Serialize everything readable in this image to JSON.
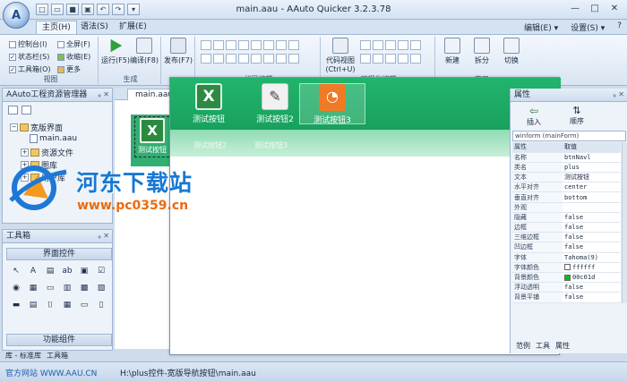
{
  "window": {
    "title": "main.aau - AAuto Quicker 3.2.3.78",
    "min": "—",
    "max": "□",
    "close": "✕"
  },
  "app_orb": "A",
  "ribbon": {
    "tabs": [
      "主页(H)",
      "语法(S)",
      "扩展(E)"
    ],
    "right_menu": [
      "编辑(E) ▾",
      "设置(S) ▾",
      "?"
    ],
    "view_group": {
      "label": "视图",
      "checks": [
        {
          "label": "控制台(I)",
          "checked": false
        },
        {
          "label": "状态栏(S)",
          "checked": true
        },
        {
          "label": "工具箱(O)",
          "checked": true
        },
        {
          "label": "全屏(F)",
          "checked": false
        },
        {
          "label": "收缩(E)",
          "checked": false
        },
        {
          "label": "更多",
          "checked": false
        }
      ]
    },
    "build_group": {
      "label": "生成",
      "buttons": [
        "运行(F5)",
        "编译(F8)"
      ]
    },
    "publish_button": "发布(F7)",
    "code_group_label": "代码编辑",
    "visual_group_label": "可视化编辑",
    "code_view_button": [
      "代码视图",
      "(Ctrl+U)"
    ],
    "new_button": "新建",
    "split_button": "拆分",
    "switch_button": "切换",
    "window_group_label": "窗口"
  },
  "project_panel": {
    "title": "AAuto工程资源管理器",
    "tree": [
      {
        "label": "宽版界面",
        "type": "folder",
        "expander": "−"
      },
      {
        "label": "main.aau",
        "type": "file"
      },
      {
        "label": "资源文件",
        "type": "folder",
        "expander": "+"
      },
      {
        "label": "图库",
        "type": "folder",
        "expander": "+"
      },
      {
        "label": "用户库",
        "type": "folder",
        "expander": "+"
      }
    ]
  },
  "toolbox": {
    "title": "工具箱",
    "sections": [
      "界面控件",
      "功能组件"
    ],
    "tools": [
      "↖",
      "A",
      "▤",
      "ab",
      "▣",
      "☑",
      "◉",
      "▦",
      "▭",
      "▥",
      "▩",
      "▧",
      "▬",
      "▤",
      "⌷",
      "▦",
      "▭",
      "▯"
    ]
  },
  "left_bottom_tabs": [
    "库 - 标准库",
    "工具箱"
  ],
  "left_link": "官方网站 WWW.AAU.CN",
  "document": {
    "tab": "main.aau",
    "tab_close": "✕",
    "designer_buttons": [
      "测试按钮",
      "测试按钮2",
      "测试按钮3"
    ],
    "ghost_labels": [
      "测试按钮2",
      "测试按钮3"
    ]
  },
  "property_panel": {
    "title": "属性",
    "tools": [
      "插入",
      "顺序"
    ],
    "combo": "winform (mainForm)",
    "rows": [
      [
        "属性",
        "取值"
      ],
      [
        "名称",
        "btnNavl"
      ],
      [
        "类名",
        "plus"
      ],
      [
        "文本",
        "测试按钮"
      ],
      [
        "水平对齐",
        "center"
      ],
      [
        "垂直对齐",
        "bottom"
      ],
      [
        "外观",
        ""
      ],
      [
        "隐藏",
        "false"
      ],
      [
        "边框",
        "false"
      ],
      [
        "三维边框",
        "false"
      ],
      [
        "凹边框",
        "false"
      ],
      [
        "字体",
        "Tahoma(9)"
      ],
      [
        "字体颜色",
        "ffffff"
      ],
      [
        "背景颜色",
        "00c01d"
      ],
      [
        "浮动透明",
        "false"
      ],
      [
        "背景平铺",
        "false"
      ]
    ],
    "colors": {
      "font": "#ffffff",
      "bg": "#00c01d"
    },
    "bottom_tabs": [
      "范例",
      "工具",
      "属性"
    ]
  },
  "status_path": "H:\\plus控件-宽版导航按钮\\main.aau",
  "watermark": {
    "title": "河东下载站",
    "url": "www.pc0359.cn"
  }
}
